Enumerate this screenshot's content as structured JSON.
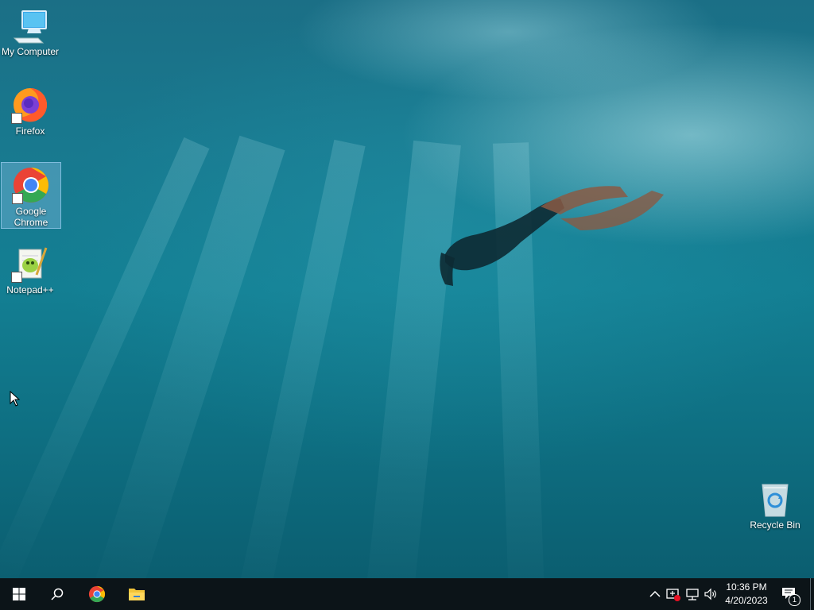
{
  "desktop": {
    "icons": [
      {
        "label": "My Computer",
        "icon": "computer-icon"
      },
      {
        "label": "Firefox",
        "icon": "firefox-icon"
      },
      {
        "label": "Google Chrome",
        "icon": "chrome-icon",
        "selected": true
      },
      {
        "label": "Notepad++",
        "icon": "notepadpp-icon"
      },
      {
        "label": "Recycle Bin",
        "icon": "recycle-bin-icon"
      }
    ]
  },
  "taskbar": {
    "start": {
      "icon": "windows-start-icon"
    },
    "search": {
      "icon": "search-icon"
    },
    "pinned": [
      {
        "name": "Google Chrome",
        "icon": "chrome-icon"
      },
      {
        "name": "File Explorer",
        "icon": "folder-icon"
      }
    ],
    "tray": {
      "icons": [
        "chevron-up-icon",
        "security-alert-icon",
        "network-icon",
        "volume-icon"
      ],
      "time": "10:36 PM",
      "date": "4/20/2023",
      "notification_count": "1"
    }
  },
  "colors": {
    "water": "#137f93",
    "taskbar": "#0c1418",
    "selection": "#96c8f0"
  }
}
